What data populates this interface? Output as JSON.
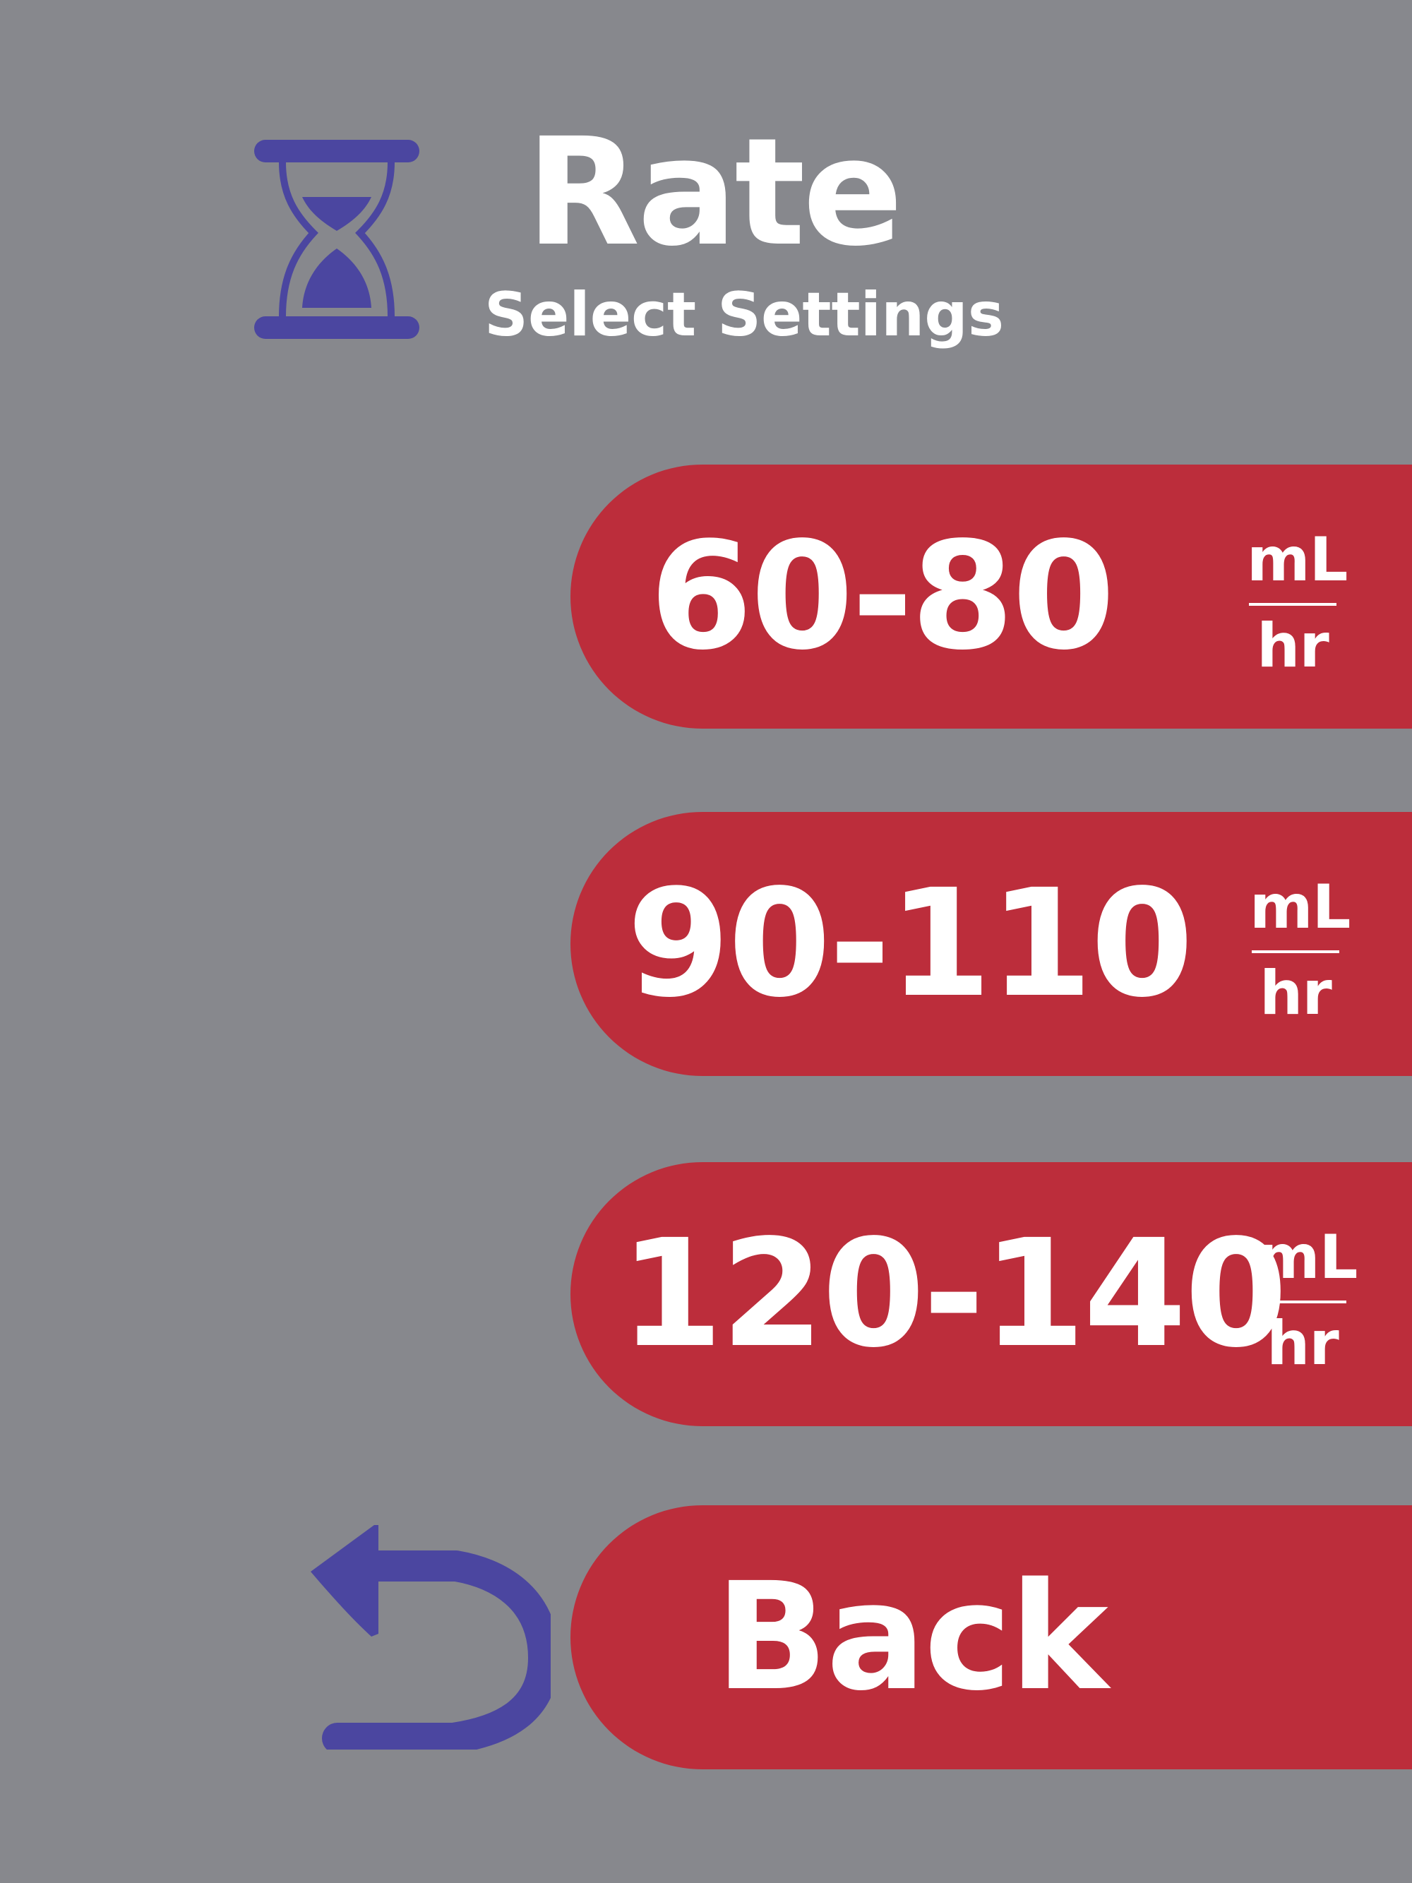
{
  "header": {
    "icon": "hourglass-icon",
    "title": "Rate",
    "subtitle": "Select Settings"
  },
  "options": [
    {
      "value": "60-80",
      "unit_top": "mL",
      "unit_bottom": "hr"
    },
    {
      "value": "90-110",
      "unit_top": "mL",
      "unit_bottom": "hr"
    },
    {
      "value": "120-140",
      "unit_top": "mL",
      "unit_bottom": "hr"
    }
  ],
  "back": {
    "icon": "back-arrow-icon",
    "label": "Back"
  },
  "colors": {
    "background": "#87888d",
    "button": "#bc2d3b",
    "icon": "#4b46a0",
    "text": "#ffffff"
  }
}
